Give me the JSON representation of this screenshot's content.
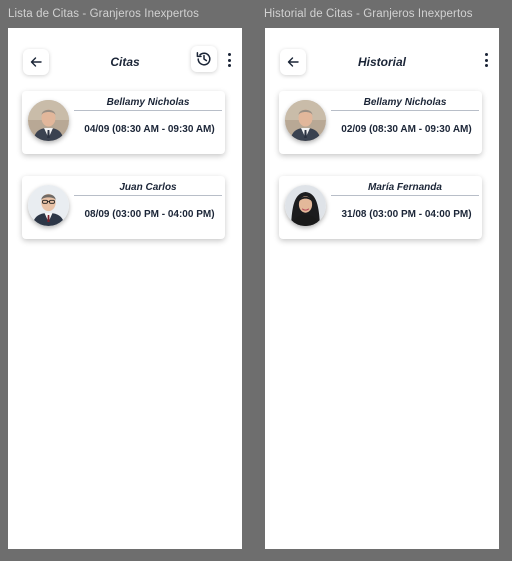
{
  "frames": [
    {
      "frame_title": "Lista de Citas - Granjeros Inexpertos",
      "screen_title": "Citas",
      "back_icon": "arrow-left-icon",
      "history_icon": "history-icon",
      "more_icon": "more-vertical-icon",
      "cards": [
        {
          "name": "Bellamy Nicholas",
          "time": "04/09 (08:30 AM - 09:30 AM)"
        },
        {
          "name": "Juan Carlos",
          "time": "08/09 (03:00 PM - 04:00 PM)"
        }
      ]
    },
    {
      "frame_title": "Historial de Citas - Granjeros Inexpertos",
      "screen_title": "Historial",
      "back_icon": "arrow-left-icon",
      "more_icon": "more-vertical-icon",
      "cards": [
        {
          "name": "Bellamy Nicholas",
          "time": "02/09 (08:30 AM - 09:30 AM)"
        },
        {
          "name": "María Fernanda",
          "time": "31/08 (03:00 PM - 04:00 PM)"
        }
      ]
    }
  ],
  "colors": {
    "canvas": "#6e6e6e",
    "screen": "#ffffff",
    "text_dark": "#1b2537",
    "frame_title": "#d2d2d2"
  }
}
